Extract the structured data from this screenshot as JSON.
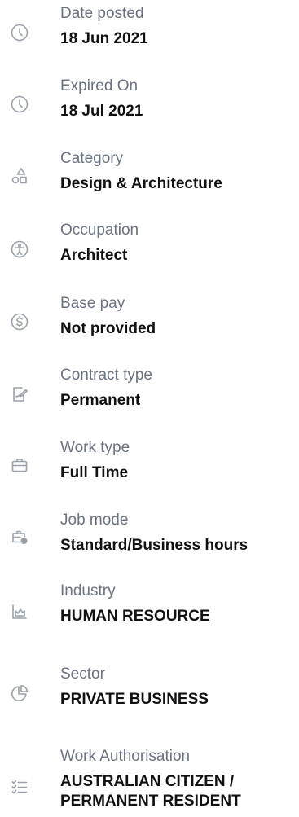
{
  "details": [
    {
      "icon": "clock-icon",
      "label": "Date posted",
      "value": "18 Jun 2021"
    },
    {
      "icon": "clock-icon",
      "label": "Expired On",
      "value": "18 Jul 2021"
    },
    {
      "icon": "shapes-icon",
      "label": "Category",
      "value": "Design & Architecture"
    },
    {
      "icon": "accessibility-icon",
      "label": "Occupation",
      "value": "Architect"
    },
    {
      "icon": "dollar-icon",
      "label": "Base pay",
      "value": "Not provided"
    },
    {
      "icon": "contract-icon",
      "label": "Contract type",
      "value": "Permanent"
    },
    {
      "icon": "briefcase-icon",
      "label": "Work type",
      "value": "Full Time"
    },
    {
      "icon": "briefcase-clock-icon",
      "label": "Job mode",
      "value": "Standard/Business hours"
    },
    {
      "icon": "chart-icon",
      "label": "Industry",
      "value": "HUMAN RESOURCE"
    },
    {
      "icon": "pie-chart-icon",
      "label": "Sector",
      "value": "PRIVATE BUSINESS"
    },
    {
      "icon": "checklist-icon",
      "label": "Work Authorisation",
      "value": "AUSTRALIAN CITIZEN / PERMANENT RESIDENT"
    }
  ]
}
